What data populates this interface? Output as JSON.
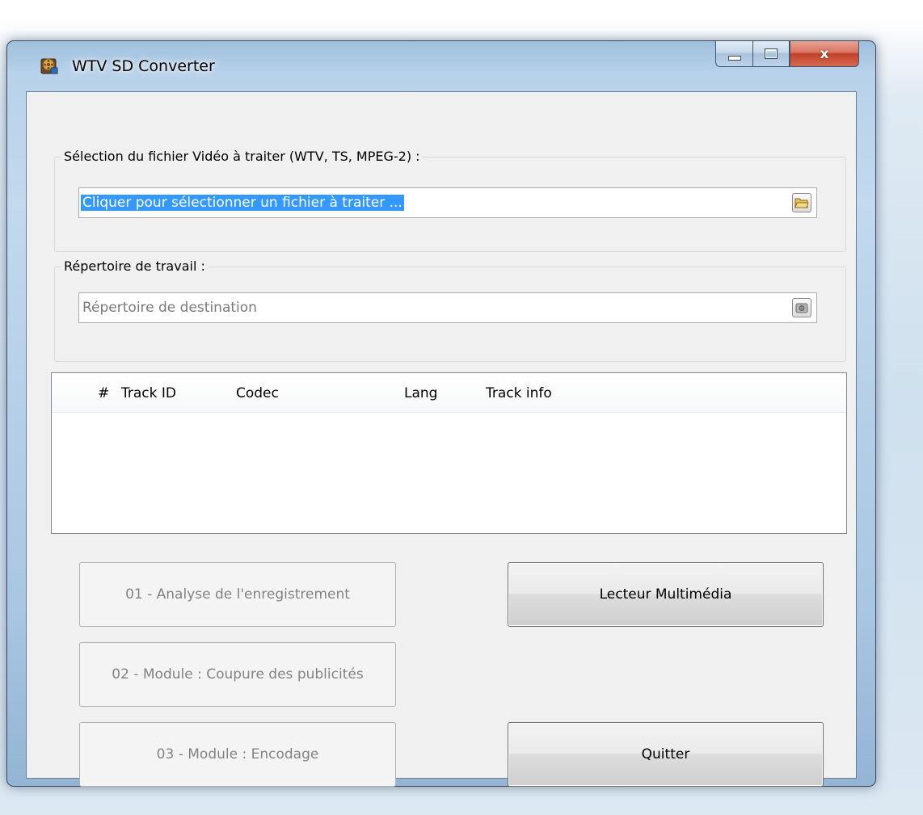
{
  "window": {
    "title": "WTV SD Converter",
    "close_glyph": "x",
    "icon": "film-reel-icon"
  },
  "source_group": {
    "label": "Sélection du fichier Vidéo à traiter (WTV, TS, MPEG-2) :",
    "field_value": "Cliquer pour sélectionner un fichier à traiter ...",
    "button_icon": "open-folder-icon"
  },
  "workdir_group": {
    "label": "Répertoire de travail :",
    "placeholder": "Répertoire de destination",
    "button_icon": "disk-icon"
  },
  "tracks": {
    "columns": [
      "#",
      "Track ID",
      "Codec",
      "Lang",
      "Track info"
    ],
    "rows": []
  },
  "buttons": {
    "analyse": "01 - Analyse de l'enregistrement",
    "cut_ads": "02 - Module : Coupure des publicités",
    "encode": "03 - Module : Encodage",
    "player": "Lecteur Multimédia",
    "quit": "Quitter"
  },
  "colors": {
    "selection": "#3399ff",
    "disabled_text": "#838383"
  }
}
